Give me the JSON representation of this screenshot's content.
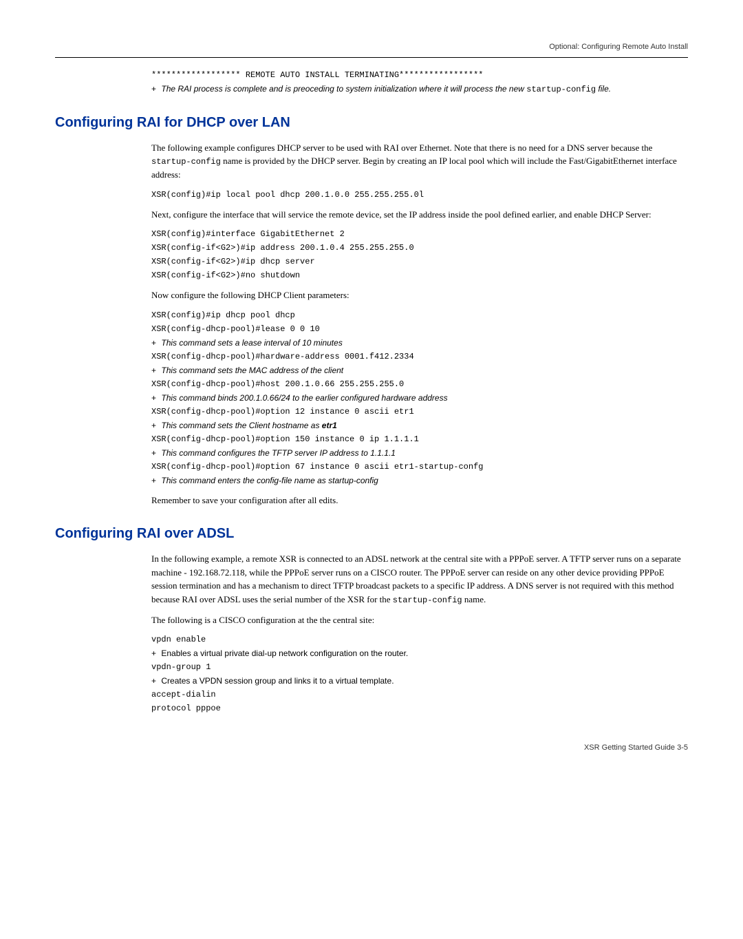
{
  "header": {
    "right": "Optional: Configuring Remote Auto Install"
  },
  "intro_block": {
    "line1": "****************** REMOTE AUTO INSTALL TERMINATING*****************",
    "plus1_italic": "The RAI process is complete and is preoceding to system initialization where it will process the new ",
    "plus1_mono": "startup-config",
    "plus1_italic_end": " file."
  },
  "section1": {
    "heading": "Configuring RAI for DHCP over LAN",
    "p1a": "The following example configures DHCP server to be used with RAI over Ethernet. Note that there is no need for a DNS server because the ",
    "p1_mono": "startup-config",
    "p1b": " name is provided by the DHCP server. Begin by creating an IP local pool which will include the Fast/GigabitEthernet interface address:",
    "cmd1": "XSR(config)#ip local pool dhcp 200.1.0.0 255.255.255.0l",
    "p2": "Next, configure the interface that will service the remote device, set the IP address inside the pool defined earlier, and enable DHCP Server:",
    "cmd2": "XSR(config)#interface GigabitEthernet 2",
    "cmd3": "XSR(config-if<G2>)#ip address 200.1.0.4 255.255.255.0",
    "cmd4": "XSR(config-if<G2>)#ip dhcp server",
    "cmd5": "XSR(config-if<G2>)#no shutdown",
    "p3": "Now configure the following DHCP Client parameters:",
    "cmd6": "XSR(config)#ip dhcp pool dhcp",
    "cmd7": "XSR(config-dhcp-pool)#lease 0 0 10",
    "note7": "This command sets a lease interval of 10 minutes",
    "cmd8": "XSR(config-dhcp-pool)#hardware-address 0001.f412.2334",
    "note8": "This command sets the MAC address of the client",
    "cmd9": "XSR(config-dhcp-pool)#host 200.1.0.66 255.255.255.0",
    "note9": "This command binds 200.1.0.66/24 to the earlier configured hardware address",
    "cmd10": "XSR(config-dhcp-pool)#option 12 instance 0 ascii etr1",
    "note10a": "This command sets the Client hostname as ",
    "note10b": "etr1",
    "cmd11": "XSR(config-dhcp-pool)#option 150 instance 0 ip 1.1.1.1",
    "note11": "This command configures the TFTP server IP address to 1.1.1.1",
    "cmd12": "XSR(config-dhcp-pool)#option 67 instance 0 ascii etr1-startup-confg",
    "note12": "This command enters the config-file name as startup-config",
    "p4": "Remember to save your configuration after all edits."
  },
  "section2": {
    "heading": "Configuring RAI over ADSL",
    "p1a": "In the following example, a remote XSR is connected to an ADSL network at the central site with a PPPoE server. A TFTP server runs on a separate machine - 192.168.72.118, while the PPPoE server runs on a CISCO router. The PPPoE server can reside on any other device providing PPPoE session termination and has a mechanism to direct TFTP broadcast packets to a specific IP address. A DNS server is not required with this method because RAI over ADSL uses the serial number of the XSR for the ",
    "p1_mono": "startup-config",
    "p1b": " name.",
    "p2": "The following is a CISCO configuration at the the central site:",
    "cmd1": "vpdn enable",
    "note1": "Enables a virtual private dial-up network configuration on the router.",
    "cmd2": "vpdn-group 1",
    "note2": "Creates a VPDN session group and links it to a virtual template.",
    "cmd3": "accept-dialin",
    "cmd4": "protocol pppoe"
  },
  "footer": {
    "text": "XSR Getting Started Guide   3-5"
  }
}
